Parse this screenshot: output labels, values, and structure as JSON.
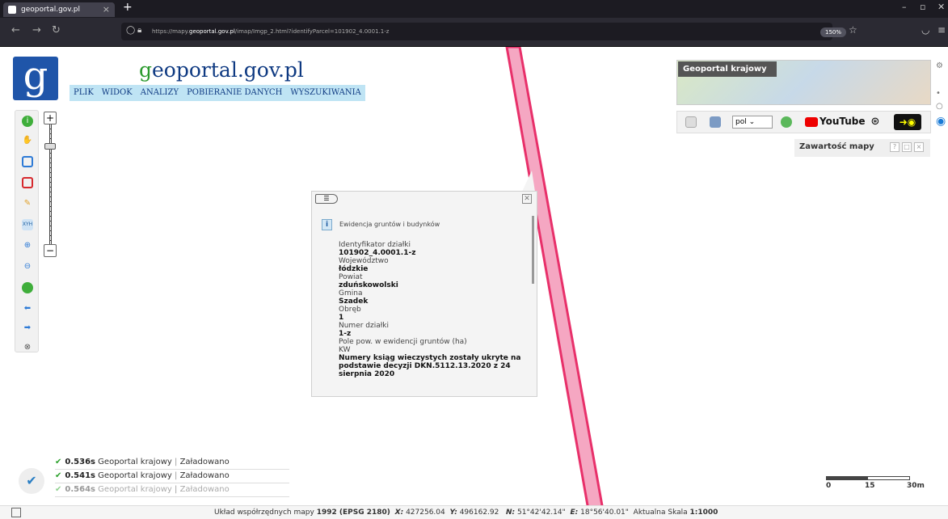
{
  "browser": {
    "tab_title": "geoportal.gov.pl",
    "tab_close": "×",
    "new_tab": "+",
    "url_prefix": "https://mapy.",
    "url_domain": "geoportal.gov.pl",
    "url_rest": "/imap/Imgp_2.html?identifyParcel=101902_4.0001.1-z",
    "zoom": "150%"
  },
  "app": {
    "brand_g": "g",
    "brand_rest": "eoportal.gov.pl",
    "menu": [
      "PLIK",
      "WIDOK",
      "ANALIZY",
      "POBIERANIE DANYCH",
      "WYSZUKIWANIA"
    ],
    "thumbnail_label": "Geoportal krajowy",
    "language": "pol",
    "youtube": "YouTube",
    "content_panel": "Zawartość mapy",
    "help": "?",
    "minimize": "□",
    "close": "×"
  },
  "popup": {
    "title": "Ewidencja gruntów i budynków",
    "fields": [
      {
        "label": "Identyfikator działki",
        "value": "101902_4.0001.1-z"
      },
      {
        "label": "Województwo",
        "value": "łódzkie"
      },
      {
        "label": "Powiat",
        "value": "zduńskowolski"
      },
      {
        "label": "Gmina",
        "value": "Szadek"
      },
      {
        "label": "Obręb",
        "value": "1"
      },
      {
        "label": "Numer działki",
        "value": "1-z"
      },
      {
        "label": "Pole pow. w ewidencji gruntów (ha)",
        "value": ""
      },
      {
        "label": "KW",
        "value": "Numery ksiąg wieczystych zostały ukryte na podstawie decyzji DKN.5112.13.2020 z 24 sierpnia 2020"
      }
    ]
  },
  "loading": [
    {
      "time": "0.536s",
      "layer": "Geoportal krajowy",
      "status": "Załadowano"
    },
    {
      "time": "0.541s",
      "layer": "Geoportal krajowy",
      "status": "Załadowano"
    },
    {
      "time": "0.564s",
      "layer": "Geoportal krajowy",
      "status": "Załadowano"
    }
  ],
  "scale": {
    "l0": "0",
    "l1": "15",
    "l2": "30m"
  },
  "status": {
    "crs_label": "Układ współrzędnych mapy",
    "crs": "1992 (EPSG 2180)",
    "x_label": "X:",
    "x": "427256.04",
    "y_label": "Y:",
    "y": "496162.92",
    "n_label": "N:",
    "n": "51°42'42.14\"",
    "e_label": "E:",
    "e": "18°56'40.01\"",
    "scale_label": "Aktualna Skala",
    "scale": "1:1000"
  },
  "colors": {
    "parcel_stroke": "#e8306a",
    "parcel_fill": "#f5a7c2",
    "menu_bg": "#bfe4f4",
    "logo_bg": "#1f55a9"
  }
}
